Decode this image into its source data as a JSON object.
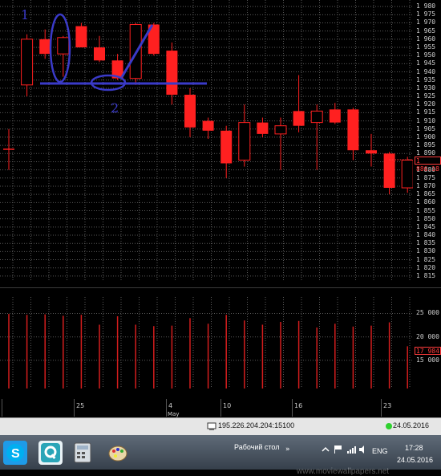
{
  "chart_data": [
    {
      "type": "candlestick",
      "title": "",
      "ylim": [
        1812,
        1984
      ],
      "y_ticks": [
        "1 980",
        "1 975",
        "1 970",
        "1 965",
        "1 960",
        "1 955",
        "1 950",
        "1 945",
        "1 940",
        "1 935",
        "1 930",
        "1 925",
        "1 920",
        "1 915",
        "1 910",
        "1 905",
        "1 900",
        "1 895",
        "1 890",
        "1 885",
        "1 880",
        "1 875",
        "1 870",
        "1 865",
        "1 860",
        "1 855",
        "1 850",
        "1 845",
        "1 840",
        "1 835",
        "1 830",
        "1 825",
        "1 820",
        "1 815"
      ],
      "y_tick_values": [
        1980,
        1975,
        1970,
        1965,
        1960,
        1955,
        1950,
        1945,
        1940,
        1935,
        1930,
        1925,
        1920,
        1915,
        1910,
        1905,
        1900,
        1895,
        1890,
        1885,
        1880,
        1875,
        1870,
        1865,
        1860,
        1855,
        1850,
        1845,
        1840,
        1835,
        1830,
        1825,
        1820,
        1815
      ],
      "current_price_label": "1 886.18",
      "colors": {
        "up": "#ff2020",
        "down": "#ff2020",
        "grid": "#5a5a5a",
        "bg": "#000000"
      },
      "candles": [
        {
          "o": 1893,
          "h": 1905,
          "l": 1880,
          "c": 1893,
          "bull": false
        },
        {
          "o": 1932,
          "h": 1963,
          "l": 1925,
          "c": 1960,
          "bull": true
        },
        {
          "o": 1960,
          "h": 1966,
          "l": 1948,
          "c": 1951,
          "bull": false
        },
        {
          "o": 1951,
          "h": 1962,
          "l": 1937,
          "c": 1961,
          "bull": true
        },
        {
          "o": 1968,
          "h": 1970,
          "l": 1955,
          "c": 1955,
          "bull": false
        },
        {
          "o": 1955,
          "h": 1962,
          "l": 1946,
          "c": 1947,
          "bull": false
        },
        {
          "o": 1947,
          "h": 1951,
          "l": 1935,
          "c": 1936,
          "bull": false
        },
        {
          "o": 1936,
          "h": 1970,
          "l": 1932,
          "c": 1969,
          "bull": true
        },
        {
          "o": 1969,
          "h": 1970,
          "l": 1950,
          "c": 1951,
          "bull": false
        },
        {
          "o": 1953,
          "h": 1958,
          "l": 1920,
          "c": 1926,
          "bull": false
        },
        {
          "o": 1926,
          "h": 1930,
          "l": 1900,
          "c": 1906,
          "bull": false
        },
        {
          "o": 1910,
          "h": 1912,
          "l": 1899,
          "c": 1904,
          "bull": false
        },
        {
          "o": 1904,
          "h": 1907,
          "l": 1875,
          "c": 1884,
          "bull": false
        },
        {
          "o": 1886,
          "h": 1920,
          "l": 1882,
          "c": 1909,
          "bull": true
        },
        {
          "o": 1909,
          "h": 1912,
          "l": 1900,
          "c": 1902,
          "bull": false
        },
        {
          "o": 1902,
          "h": 1912,
          "l": 1880,
          "c": 1907,
          "bull": true
        },
        {
          "o": 1907,
          "h": 1938,
          "l": 1903,
          "c": 1916,
          "bull": false
        },
        {
          "o": 1909,
          "h": 1920,
          "l": 1880,
          "c": 1916,
          "bull": true
        },
        {
          "o": 1917,
          "h": 1921,
          "l": 1908,
          "c": 1909,
          "bull": false
        },
        {
          "o": 1917,
          "h": 1918,
          "l": 1886,
          "c": 1892,
          "bull": false
        },
        {
          "o": 1892,
          "h": 1902,
          "l": 1882,
          "c": 1890,
          "bull": false
        },
        {
          "o": 1890,
          "h": 1891,
          "l": 1865,
          "c": 1869,
          "bull": false
        },
        {
          "o": 1869,
          "h": 1888,
          "l": 1866,
          "c": 1886,
          "bull": true
        }
      ],
      "annotations": [
        {
          "label": "1",
          "color": "#3a3ac8"
        },
        {
          "label": "2",
          "color": "#3a3ac8"
        }
      ]
    },
    {
      "type": "bar",
      "title": "",
      "ylim": [
        9000,
        28500
      ],
      "y_ticks": [
        "25 000",
        "20 000",
        "15 000"
      ],
      "y_tick_values": [
        25000,
        20000,
        15000
      ],
      "current_value_label": "17 984",
      "values": [
        24900,
        24700,
        24800,
        24500,
        24700,
        22600,
        24400,
        22600,
        22300,
        22400,
        24000,
        22800,
        24700,
        23500,
        22600,
        23200,
        23400,
        22000,
        22800,
        22200,
        22400,
        23100,
        18000
      ],
      "colors": {
        "bar": "#d41d1d"
      }
    }
  ],
  "time_axis": {
    "labels": [
      "25",
      "4",
      "May",
      "10",
      "16",
      "23"
    ]
  },
  "status_bar": {
    "ip": "195.226.204.204:15100",
    "date": "24.05.2016"
  },
  "taskbar": {
    "desktop_label": "Рабочий стол",
    "language": "ENG",
    "clock_time": "17:28",
    "clock_date": "24.05.2016",
    "watermark": "www.moviewallpapers.net"
  }
}
